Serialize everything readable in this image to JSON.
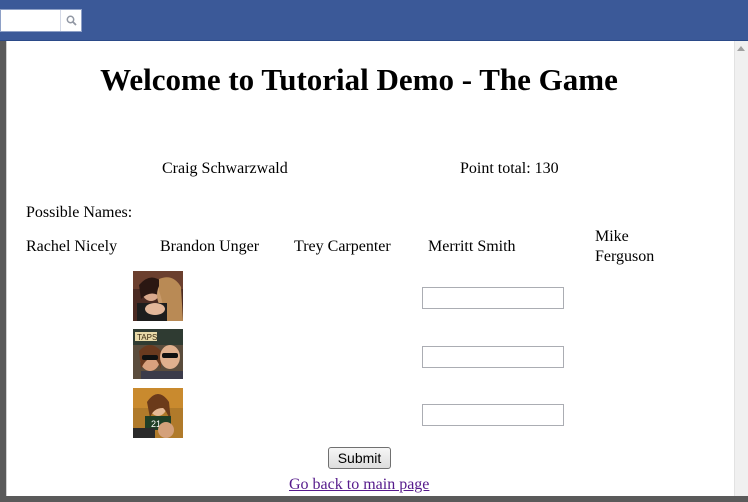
{
  "header": {
    "search": {
      "value": "",
      "placeholder": ""
    }
  },
  "page": {
    "title": "Welcome to Tutorial Demo - The Game",
    "player_name": "Craig Schwarzwald",
    "points_label": "Point total: 130",
    "possible_names_label": "Possible Names:",
    "names": [
      "Rachel Nicely",
      "Brandon Unger",
      "Trey Carpenter",
      "Merritt Smith",
      "Mike",
      "Ferguson"
    ],
    "photos": [
      {
        "icon": "person-photo-1"
      },
      {
        "icon": "person-photo-2"
      },
      {
        "icon": "person-photo-3"
      }
    ],
    "answers": [
      "",
      "",
      ""
    ],
    "submit_label": "Submit",
    "back_link": "Go back to main page"
  }
}
